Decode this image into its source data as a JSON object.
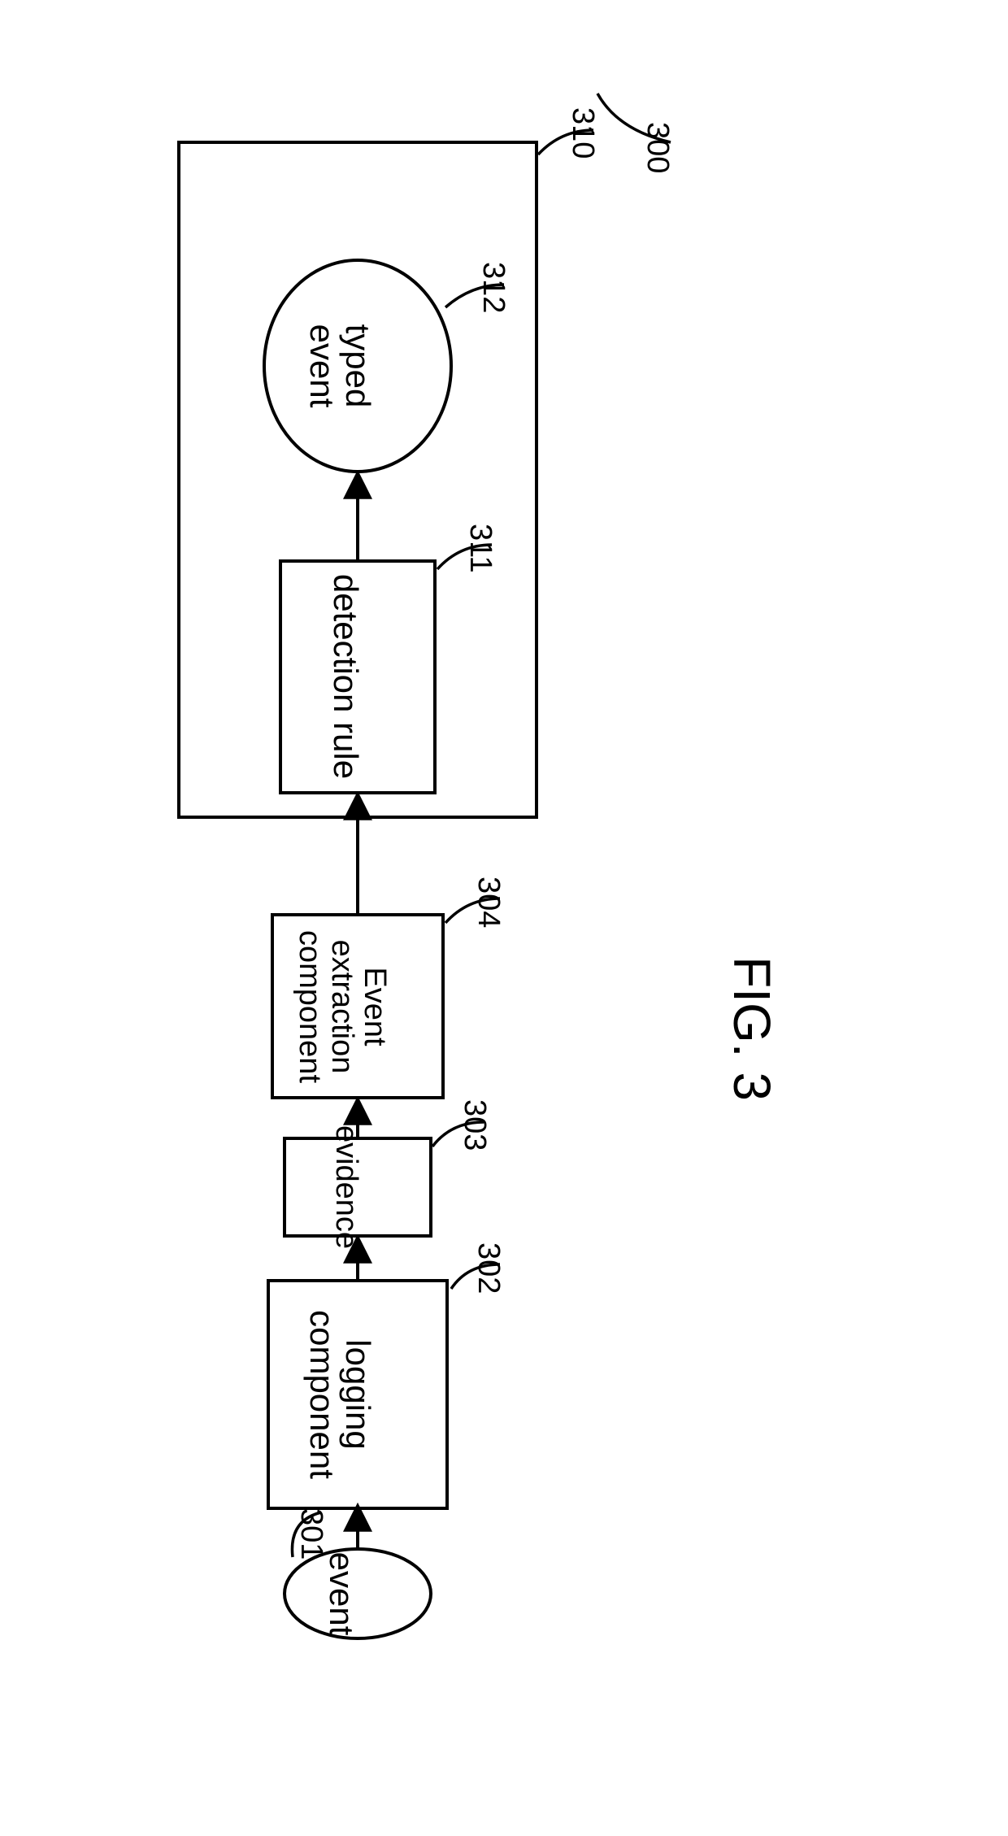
{
  "figure": {
    "number_label": "FIG. 3",
    "system_ref": "300"
  },
  "nodes": {
    "event": {
      "label": "event",
      "ref": "301"
    },
    "logging": {
      "label": "logging\ncomponent",
      "ref": "302"
    },
    "evidence": {
      "label": "evidence",
      "ref": "303"
    },
    "extract": {
      "label": "Event\nextraction\ncomponent",
      "ref": "304"
    },
    "detect": {
      "label": "detection rule",
      "ref": "311"
    },
    "typed": {
      "label": "typed\nevent",
      "ref": "312"
    },
    "container": {
      "ref": "310"
    }
  }
}
